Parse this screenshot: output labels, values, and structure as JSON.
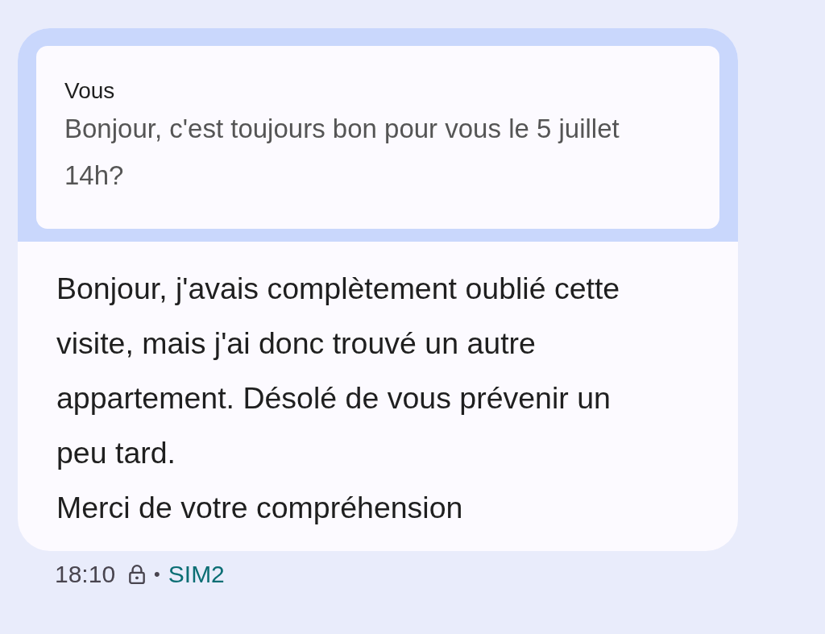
{
  "message": {
    "quote": {
      "sender": "Vous",
      "text": "Bonjour, c'est toujours bon pour vous le 5 juillet 14h?"
    },
    "text": "Bonjour, j'avais complètement oublié cette visite, mais j'ai donc trouvé un autre  appartement. Désolé de vous prévenir un peu tard.\nMerci de votre compréhension",
    "time": "18:10",
    "locked": true,
    "separator": "•",
    "sim": "SIM2"
  }
}
